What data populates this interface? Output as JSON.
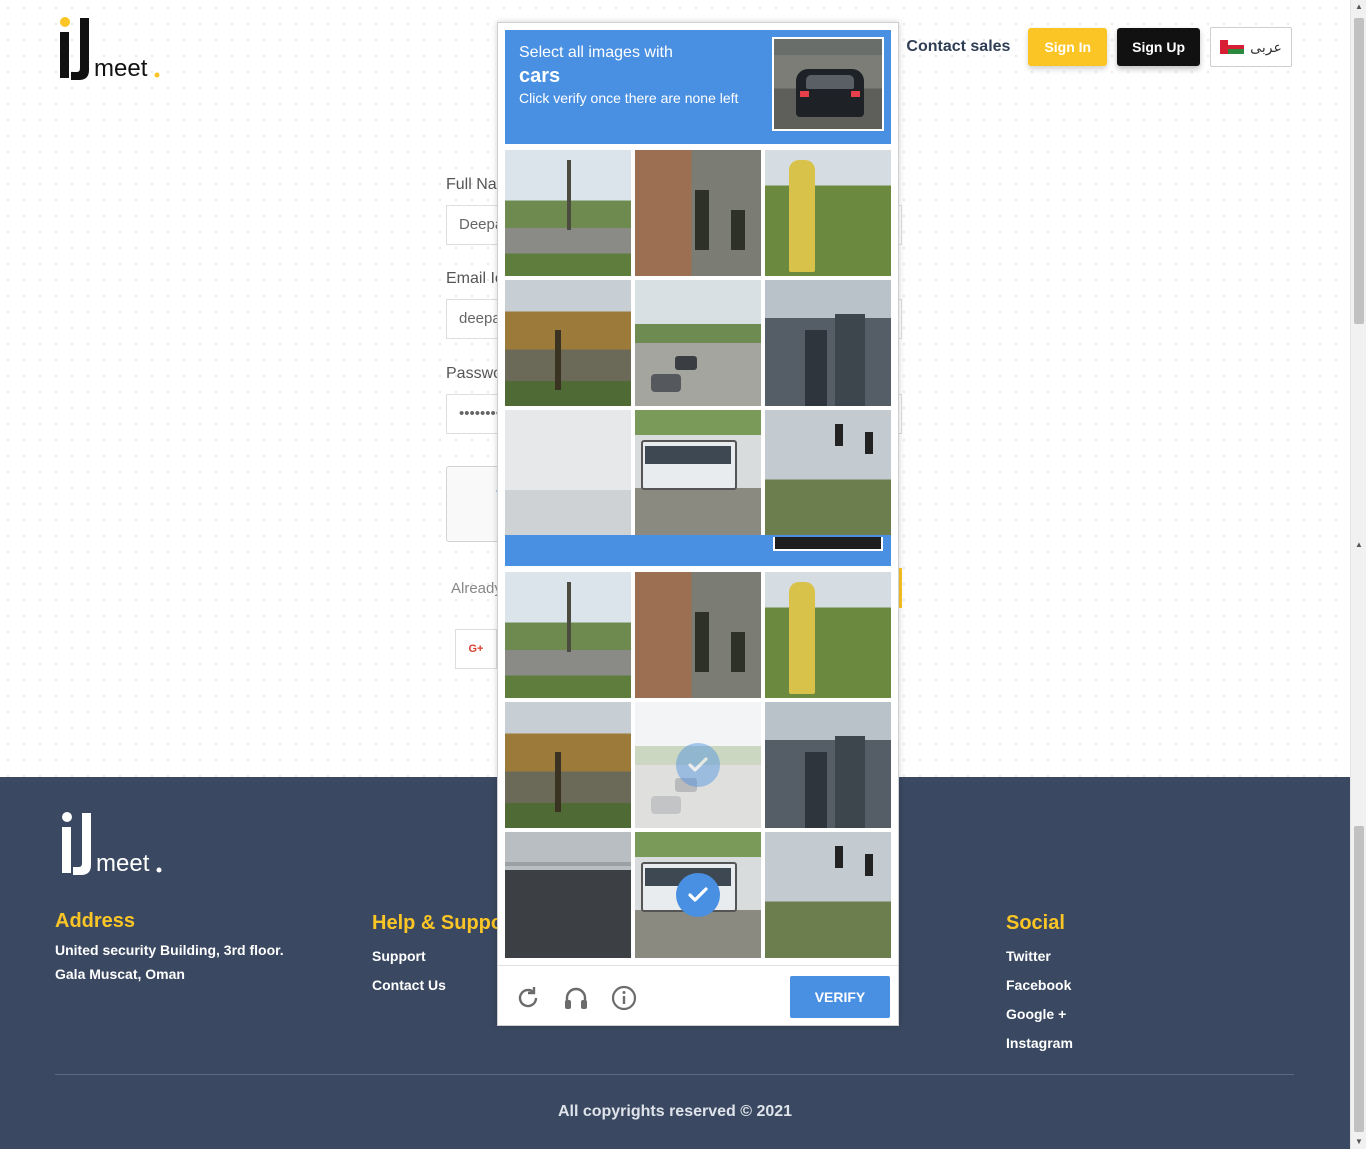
{
  "header": {
    "contact_sales": "Contact sales",
    "sign_in": "Sign In",
    "sign_up": "Sign Up",
    "language": "عربى",
    "logo_text": "meet."
  },
  "form": {
    "full_name_label": "Full Nar",
    "full_name_value": "Deepa",
    "email_label": "Email Ic",
    "email_value": "deepa",
    "password_label": "Passwo",
    "password_value": "••••••••",
    "already": "Already",
    "google_label": "G+"
  },
  "captcha": {
    "line1": "Select all images with",
    "target": "cars",
    "line3": "Click verify once there are none left",
    "verify": "VERIFY",
    "tiles_top": [
      {
        "scene": "road-trees"
      },
      {
        "scene": "traffic-light-building"
      },
      {
        "scene": "hydrant"
      },
      {
        "scene": "autumn-trees"
      },
      {
        "scene": "street-cars"
      },
      {
        "scene": "skyscrapers"
      },
      {
        "scene": "fog-bridge"
      },
      {
        "scene": "bus"
      },
      {
        "scene": "traffic-light-sky"
      }
    ],
    "tiles_bottom": [
      {
        "scene": "road-trees",
        "selected": false
      },
      {
        "scene": "traffic-light-building",
        "selected": false
      },
      {
        "scene": "hydrant",
        "selected": false
      },
      {
        "scene": "autumn-trees",
        "selected": false
      },
      {
        "scene": "street-cars",
        "selected": true,
        "faded": true
      },
      {
        "scene": "skyscrapers",
        "selected": false
      },
      {
        "scene": "wet-bridge",
        "selected": false
      },
      {
        "scene": "bus",
        "selected": true
      },
      {
        "scene": "traffic-light-sky",
        "selected": false
      }
    ],
    "icons": [
      "reload-icon",
      "audio-icon",
      "info-icon"
    ]
  },
  "footer": {
    "logo_text": "meet.",
    "address_title": "Address",
    "address_line1": "United security Building, 3rd floor.",
    "address_line2": "Gala Muscat, Oman",
    "help_title": "Help & Suppor",
    "help_links": [
      "Support",
      "Contact Us"
    ],
    "social_title": "Social",
    "social_links": [
      "Twitter",
      "Facebook",
      "Google +",
      "Instagram"
    ],
    "copyright": "All copyrights reserved © 2021"
  },
  "colors": {
    "accent_yellow": "#fbc525",
    "footer_bg": "#3a4961",
    "captcha_blue": "#4a90e2"
  }
}
